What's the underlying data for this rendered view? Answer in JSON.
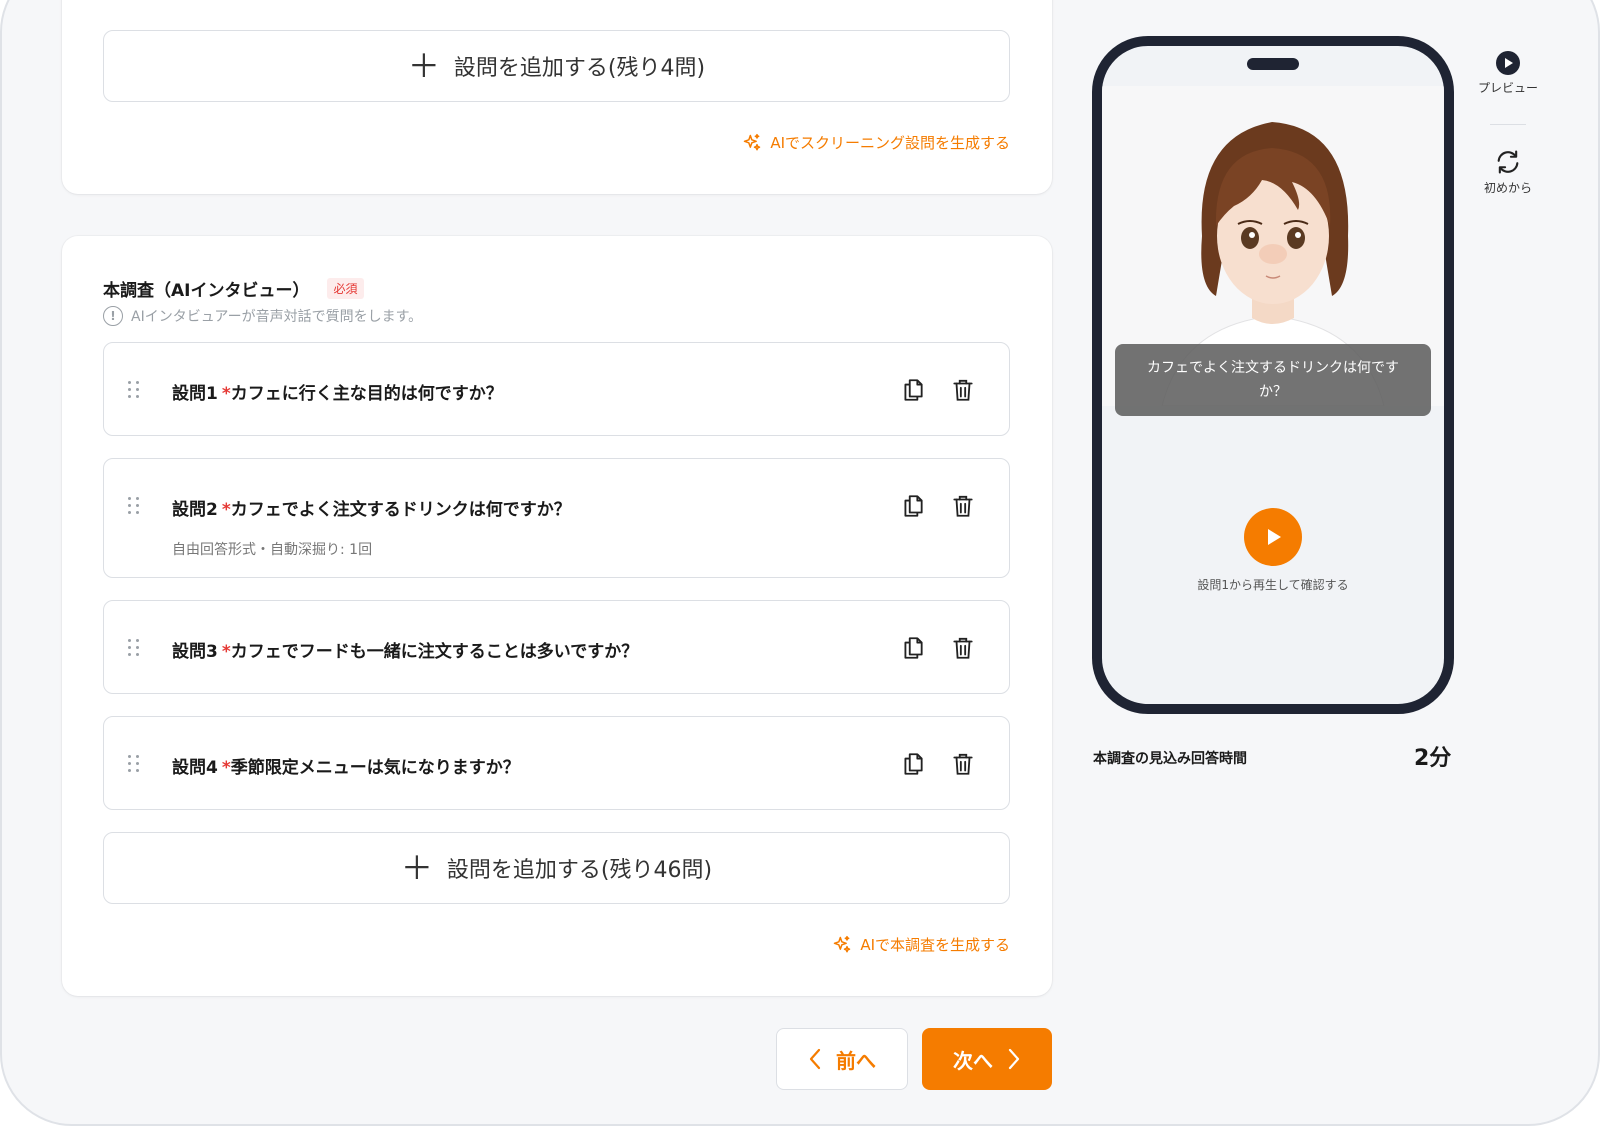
{
  "screening": {
    "add_label": "設問を追加する(残り4問)",
    "ai_generate": "AIでスクリーニング設問を生成する"
  },
  "main_survey": {
    "title": "本調査（AIインタビュー）",
    "required_badge": "必須",
    "subtitle": "AIインタビュアーが音声対話で質問をします。",
    "questions": [
      {
        "label": "設問1",
        "text": "カフェに行く主な目的は何ですか？",
        "meta": ""
      },
      {
        "label": "設問2",
        "text": "カフェでよく注文するドリンクは何ですか？",
        "meta": "自由回答形式・自動深掘り: 1回"
      },
      {
        "label": "設問3",
        "text": "カフェでフードも一緒に注文することは多いですか？",
        "meta": ""
      },
      {
        "label": "設問4",
        "text": "季節限定メニューは気になりますか？",
        "meta": ""
      }
    ],
    "add_label": "設問を追加する(残り46問)",
    "ai_generate": "AIで本調査を生成する"
  },
  "nav": {
    "prev_label": "前へ",
    "next_label": "次へ"
  },
  "preview": {
    "caption": "カフェでよく注文するドリンクは何ですか？",
    "play_label": "設問1から再生して確認する",
    "estimate_label": "本調査の見込み回答時間",
    "estimate_value": "2分"
  },
  "side_tools": {
    "preview_label": "プレビュー",
    "restart_label": "初めから"
  },
  "colors": {
    "accent": "#f57c00",
    "required": "#e53935",
    "phone_frame": "#1f2433"
  }
}
